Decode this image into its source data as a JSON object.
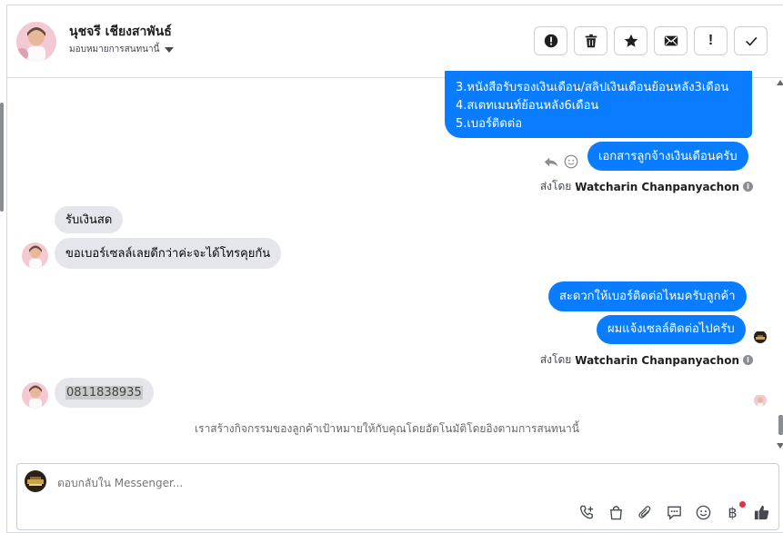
{
  "header": {
    "contact_name": "นุชจรี เชียงสาพันธ์",
    "assign_label": "มอบหมายการสนทนานี้",
    "actions": [
      {
        "name": "spam-button",
        "icon": "alert-circle-icon"
      },
      {
        "name": "delete-button",
        "icon": "trash-icon"
      },
      {
        "name": "star-button",
        "icon": "star-icon"
      },
      {
        "name": "mark-unread-button",
        "icon": "envelope-icon"
      },
      {
        "name": "follow-up-button",
        "label": "!"
      },
      {
        "name": "mark-done-button",
        "icon": "check-icon"
      }
    ]
  },
  "messages": {
    "out1_lines": [
      "3.หนังสือรับรองเงินเดือน/สลิปเงินเดือนย้อนหลัง3เดือน",
      "4.สเตทเมนท์ย้อนหลัง6เดือน",
      "5.เบอร์ติดต่อ"
    ],
    "out2": "เอกสารลูกจ้างเงินเดือนครับ",
    "sent_by_prefix": "ส่งโดย",
    "sent_by_name": "Watcharin Chanpanyachon",
    "in1": "รับเงินสด",
    "in2": "ขอเบอร์เซลล์เลยดีกว่าค่ะจะได้โทรคุยกัน",
    "out3": "สะดวกให้เบอร์ติดต่อไหมครับลูกค้า",
    "out4": "ผมแจ้งเซลล์ติดต่อไปครับ",
    "in3": "0811838935",
    "system_note": "เราสร้างกิจกรรมของลูกค้าเป้าหมายให้กับคุณโดยอัตโนมัติโดยอิงตามการสนทนานี้"
  },
  "composer": {
    "placeholder": "ตอบกลับใน Messenger...",
    "tools": [
      "phone-add-icon",
      "shopping-bag-icon",
      "paperclip-icon",
      "saved-reply-icon",
      "emoji-icon",
      "baht-payment-icon",
      "thumbs-up-icon"
    ],
    "baht_symbol": "฿"
  },
  "colors": {
    "outgoing": "#0a7cff",
    "incoming": "#e4e6eb",
    "alert_dot": "#f02849"
  }
}
